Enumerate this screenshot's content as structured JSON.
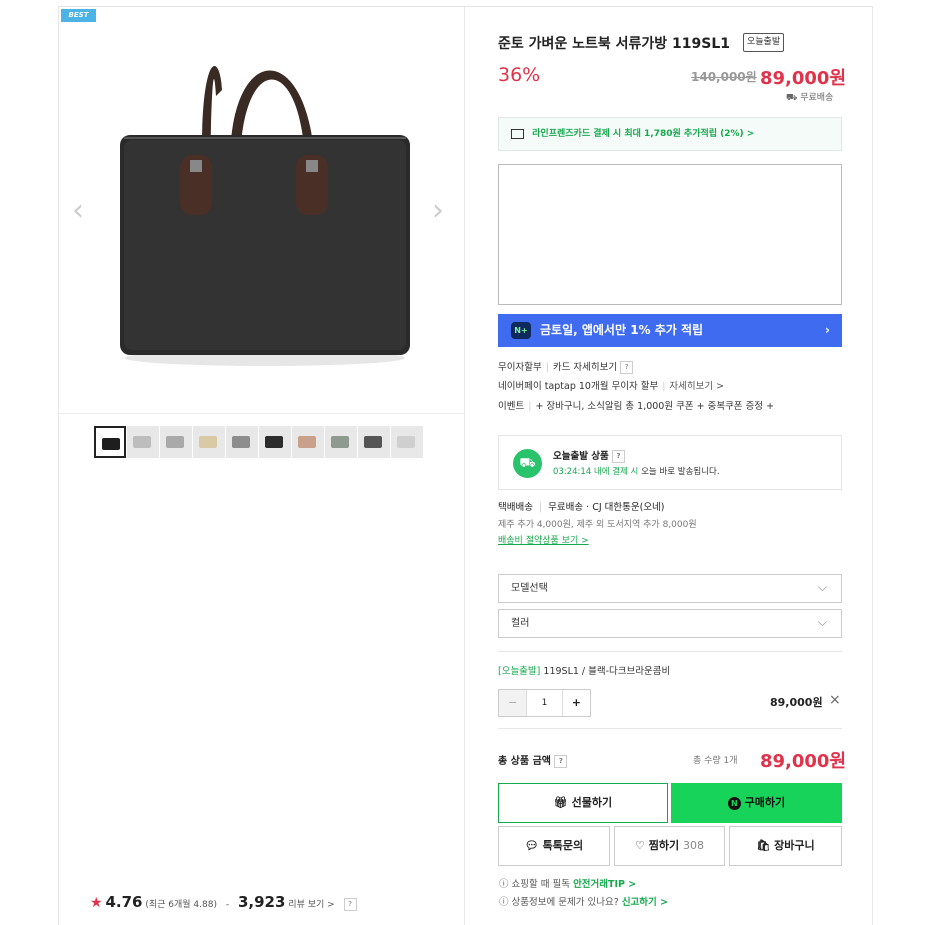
{
  "product": {
    "badge": "BEST",
    "title": "준토 가벼운 노트북 서류가방 119SL1",
    "tag": "오늘출발",
    "discount": "36%",
    "original_price": "140,000원",
    "sale_price": "89,000원",
    "free_shipping": "무료배송"
  },
  "gallery": {
    "prev": "‹",
    "next": "›",
    "thumbnail_colors": [
      "#1e1e1e",
      "#bdbdbd",
      "#a9a9a9",
      "#d9c9a5",
      "#8d8d8d",
      "#2c2c2c",
      "#c9a08a",
      "#8f9a8f",
      "#555555",
      "#cfcfcf"
    ]
  },
  "card_benefit": "라인프렌즈카드 결제 시 최대 1,780원 추가적립 (2%) >",
  "promo": {
    "icon": "N+",
    "text": "금토일, 앱에서만 1% 추가 적립",
    "chevron": "›"
  },
  "benefits": {
    "line1_label": "무이자할부",
    "line1_link": "카드 자세히보기",
    "line2_label": "네이버페이 taptap 10개월 무이자 할부",
    "line2_link": "자세히보기 >",
    "line3_label": "이벤트",
    "line3_text": "+ 장바구니, 소식알림 총 1,000원 쿠폰 + 중복쿠폰 증정 +"
  },
  "today_ship": {
    "title": "오늘출발 상품",
    "timer": "03:24:14 내에 결제 시",
    "desc": "오늘 바로 발송됩니다."
  },
  "delivery": {
    "type": "택배배송",
    "method": "무료배송 · CJ 대한통운(오네)",
    "extra": "제주 추가 4,000원, 제주 외 도서지역 추가 8,000원",
    "link": "배송비 절약상품 보기 >"
  },
  "options": {
    "select1": "모델선택",
    "select2": "컬러",
    "selected_tag": "[오늘출발]",
    "selected_name": "119SL1 / 블랙-다크브라운콤비",
    "minus": "−",
    "qty": "1",
    "plus": "+",
    "price": "89,000원",
    "remove": "×"
  },
  "total": {
    "label": "총 상품 금액",
    "qty_text": "총 수량 1개",
    "price": "89,000원"
  },
  "actions": {
    "gift": "선물하기",
    "buy": "구매하기",
    "talk": "톡톡문의",
    "wish": "찜하기",
    "wish_count": "308",
    "cart": "장바구니"
  },
  "footer": {
    "line1_text": "쇼핑할 때 필독",
    "line1_link": "안전거래TIP >",
    "line2_text": "상품정보에 문제가 있나요?",
    "line2_link": "신고하기 >"
  },
  "review": {
    "rating": "4.76",
    "recent": "(최근 6개월 4.88)",
    "dash": "-",
    "count": "3,923",
    "link": "리뷰 보기 >"
  }
}
